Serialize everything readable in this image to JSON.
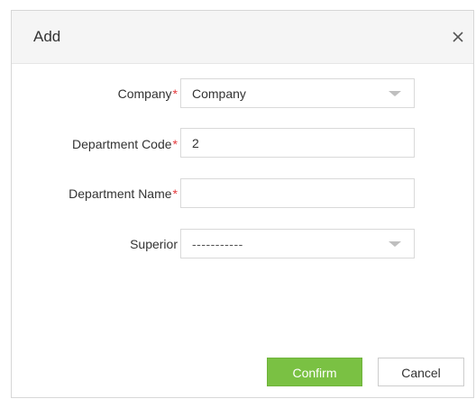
{
  "dialog": {
    "title": "Add",
    "close_icon": "close-icon"
  },
  "form": {
    "company": {
      "label": "Company",
      "required_mark": "*",
      "value": "Company"
    },
    "department_code": {
      "label": "Department Code",
      "required_mark": "*",
      "value": "2"
    },
    "department_name": {
      "label": "Department Name",
      "required_mark": "*",
      "value": ""
    },
    "superior": {
      "label": "Superior",
      "value": "-----------"
    }
  },
  "buttons": {
    "confirm_label": "Confirm",
    "cancel_label": "Cancel"
  },
  "colors": {
    "confirm": "#7ac143",
    "required": "#e4393c",
    "header_bg": "#f5f5f5"
  }
}
